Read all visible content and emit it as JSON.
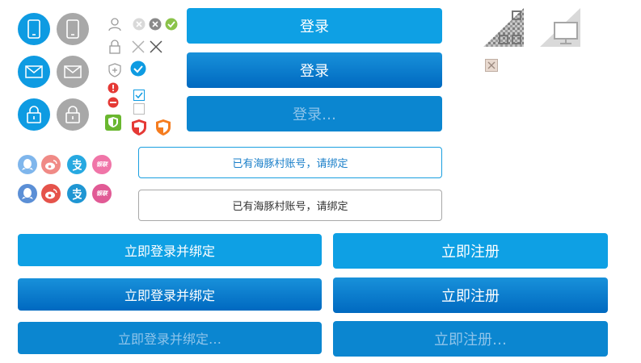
{
  "buttons": {
    "login": "登录",
    "login_pressed": "登录",
    "login_loading": "登录…",
    "bind_existing_active": "已有海豚村账号，请绑定",
    "bind_existing": "已有海豚村账号，请绑定",
    "login_bind": "立即登录并绑定",
    "login_bind_pressed": "立即登录并绑定",
    "login_bind_loading": "立即登录并绑定…",
    "register": "立即注册",
    "register_pressed": "立即注册",
    "register_loading": "立即注册…"
  },
  "social": {
    "unionpay_label": "银联"
  },
  "colors": {
    "primary": "#0ea0e4",
    "primary_dark": "#0069c0",
    "disabled_text": "#8fc4ea",
    "icon_gray": "#a8a8a8",
    "success": "#8bc34a",
    "error": "#e53935"
  },
  "icons": [
    "phone-icon",
    "mail-icon",
    "lock-icon",
    "user-icon",
    "clear-icon",
    "close-icon",
    "shield-plus-icon",
    "check-circle-icon",
    "warning-icon",
    "minus-circle-icon",
    "checkbox-checked-icon",
    "checkbox-empty-icon",
    "safe-shield-icon",
    "qq-icon",
    "weibo-icon",
    "alipay-icon",
    "unionpay-icon",
    "qrcode-corner-icon",
    "monitor-corner-icon",
    "image-broken-icon"
  ]
}
